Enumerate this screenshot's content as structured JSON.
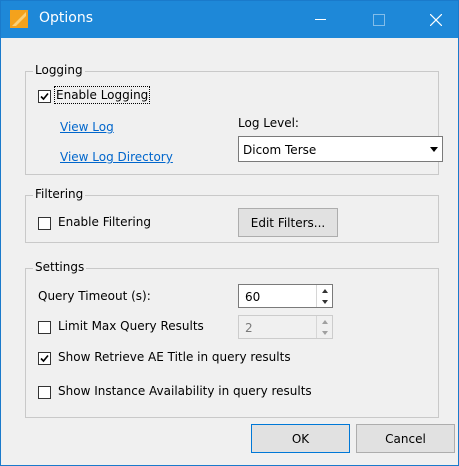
{
  "window": {
    "title": "Options",
    "icon": "options-app-icon",
    "controls": [
      "minimize",
      "maximize",
      "close"
    ]
  },
  "logging": {
    "group_label": "Logging",
    "enable_logging_label": "Enable Logging",
    "enable_logging_checked": true,
    "view_log_link": "View Log",
    "view_log_directory_link": "View Log Directory",
    "log_level_label": "Log Level:",
    "log_level_value": "Dicom Terse"
  },
  "filtering": {
    "group_label": "Filtering",
    "enable_filtering_label": "Enable Filtering",
    "enable_filtering_checked": false,
    "edit_filters_button": "Edit Filters..."
  },
  "settings": {
    "group_label": "Settings",
    "query_timeout_label": "Query Timeout (s):",
    "query_timeout_value": "60",
    "limit_max_label": "Limit Max Query Results",
    "limit_max_checked": false,
    "limit_max_value": "2",
    "show_retrieve_label": "Show Retrieve AE Title in query results",
    "show_retrieve_checked": true,
    "show_instance_label": "Show Instance Availability in query results",
    "show_instance_checked": false
  },
  "buttons": {
    "ok": "OK",
    "cancel": "Cancel"
  },
  "colors": {
    "titlebar": "#1e88d8",
    "link": "#0066cc",
    "dialog_bg": "#f0f0f0"
  }
}
